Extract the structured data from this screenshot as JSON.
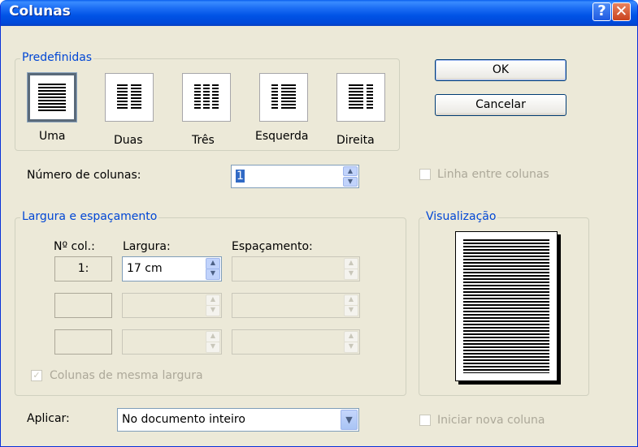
{
  "window": {
    "title": "Colunas",
    "help": "?",
    "close": "✕"
  },
  "presets": {
    "legend": "Predefinidas",
    "items": [
      {
        "label": "Uma",
        "selected": true
      },
      {
        "label": "Duas"
      },
      {
        "label": "Três"
      },
      {
        "label": "Esquerda"
      },
      {
        "label": "Direita"
      }
    ]
  },
  "buttons": {
    "ok": "OK",
    "cancel": "Cancelar"
  },
  "num_cols": {
    "label": "Número de colunas:",
    "value": "1"
  },
  "line_between": {
    "label": "Linha entre colunas",
    "checked": false,
    "enabled": false
  },
  "width_spacing": {
    "legend": "Largura e espaçamento",
    "headers": {
      "col": "Nº col.:",
      "width": "Largura:",
      "spacing": "Espaçamento:"
    },
    "rows": [
      {
        "col": "1:",
        "width": "17 cm",
        "spacing": ""
      },
      {
        "col": "",
        "width": "",
        "spacing": ""
      },
      {
        "col": "",
        "width": "",
        "spacing": ""
      }
    ],
    "equal_width": {
      "label": "Colunas de mesma largura",
      "checked": true,
      "enabled": false
    }
  },
  "preview": {
    "legend": "Visualização"
  },
  "apply": {
    "label": "Aplicar:",
    "value": "No documento inteiro"
  },
  "new_column": {
    "label": "Iniciar nova coluna",
    "checked": false,
    "enabled": false
  }
}
